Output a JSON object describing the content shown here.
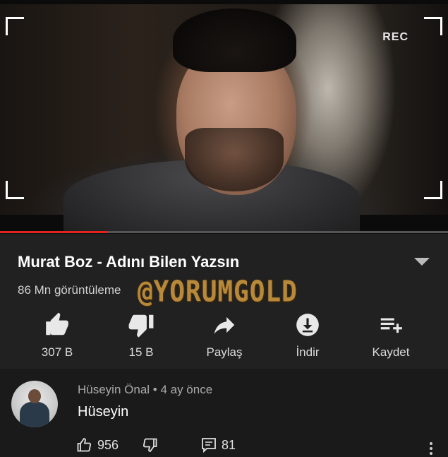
{
  "video": {
    "rec_label": "REC",
    "progress_fraction": 0.24,
    "progress_color": "#e52222"
  },
  "info": {
    "title": "Murat Boz - Adını Bilen Yazsın",
    "views": "86 Mn görüntüleme",
    "watermark": "@YORUMGOLD",
    "expand_icon": "chevron-down-icon"
  },
  "actions": [
    {
      "icon": "thumbs-up-icon",
      "label": "307 B"
    },
    {
      "icon": "thumbs-down-icon",
      "label": "15 B"
    },
    {
      "icon": "share-icon",
      "label": "Paylaş"
    },
    {
      "icon": "download-icon",
      "label": "İndir"
    },
    {
      "icon": "playlist-add-icon",
      "label": "Kaydet"
    }
  ],
  "comment": {
    "author": "Hüseyin Önal • 4 ay önce",
    "text": "Hüseyin",
    "likes": "956",
    "replies": "81"
  },
  "colors": {
    "background": "#212121",
    "watermark": "#b8893a"
  }
}
